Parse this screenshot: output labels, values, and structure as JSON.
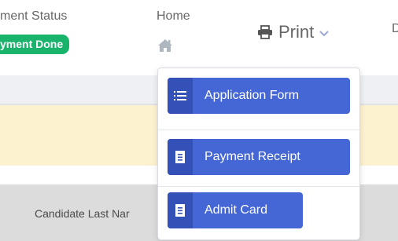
{
  "header": {
    "payment_status_label": "yment Status",
    "payment_badge": "yment Done",
    "home_label": "Home",
    "print_label": "Print",
    "cut_letter": "D"
  },
  "content": {
    "candidate_label": "Candidate Last Nar"
  },
  "print_menu": {
    "items": [
      {
        "label": "Application Form",
        "icon": "list-icon"
      },
      {
        "label": "Payment Receipt",
        "icon": "receipt-icon"
      },
      {
        "label": "Admit Card",
        "icon": "receipt-icon"
      }
    ]
  },
  "colors": {
    "badge_green": "#1ab36b",
    "button_blue": "#4567d5",
    "button_icon_blue": "#3451b8",
    "alert_yellow": "#fdf2d0",
    "text_gray": "#666666"
  }
}
